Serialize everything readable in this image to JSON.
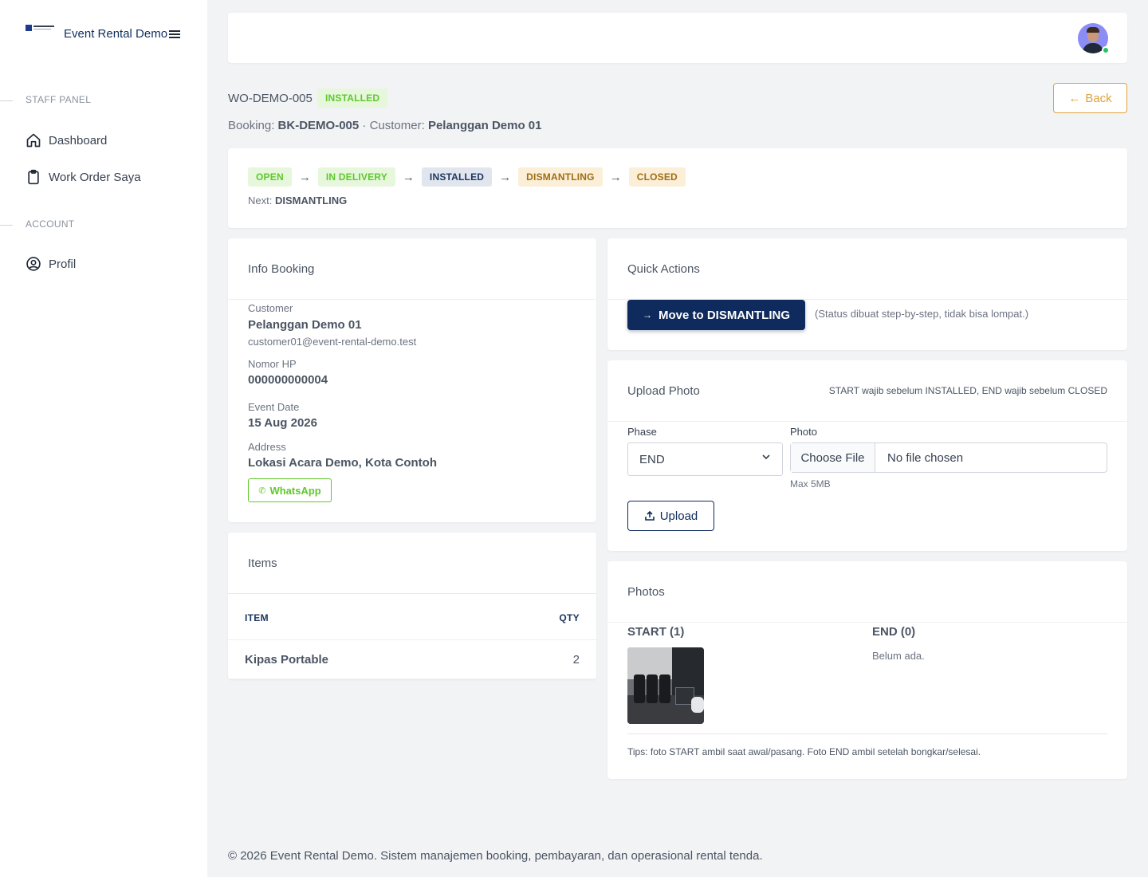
{
  "app": {
    "brand_name": "Event Rental Demo"
  },
  "sidebar": {
    "section_staff": "STAFF PANEL",
    "section_account": "ACCOUNT",
    "items": [
      {
        "label": "Dashboard",
        "icon": "home-icon"
      },
      {
        "label": "Work Order Saya",
        "icon": "clipboard-icon"
      },
      {
        "label": "Profil",
        "icon": "user-circle-icon"
      }
    ]
  },
  "header": {
    "wo_code": "WO-DEMO-005",
    "status": "INSTALLED",
    "booking_label": "Booking:",
    "booking_code": "BK-DEMO-005",
    "customer_label": "· Customer:",
    "customer_name": "Pelanggan Demo 01",
    "back_label": "Back"
  },
  "flow": {
    "steps": [
      "OPEN",
      "IN DELIVERY",
      "INSTALLED",
      "DISMANTLING",
      "CLOSED"
    ],
    "arrow": "→",
    "next_label": "Next:",
    "next_value": "DISMANTLING"
  },
  "info_booking": {
    "title": "Info Booking",
    "customer_label": "Customer",
    "customer_name": "Pelanggan Demo 01",
    "customer_email": "customer01@event-rental-demo.test",
    "phone_label": "Nomor HP",
    "phone": "000000000004",
    "event_date_label": "Event Date",
    "event_date": "15 Aug 2026",
    "address_label": "Address",
    "address": "Lokasi Acara Demo, Kota Contoh",
    "whatsapp_label": "WhatsApp"
  },
  "items": {
    "title": "Items",
    "headers": {
      "item": "ITEM",
      "qty": "QTY"
    },
    "rows": [
      {
        "item": "Kipas Portable",
        "qty": "2"
      }
    ]
  },
  "quick_actions": {
    "title": "Quick Actions",
    "move_label": "Move to DISMANTLING",
    "note": "(Status dibuat step-by-step, tidak bisa lompat.)"
  },
  "upload": {
    "title": "Upload Photo",
    "note": "START wajib sebelum INSTALLED, END wajib sebelum CLOSED",
    "phase_label": "Phase",
    "phase_value": "END",
    "photo_label": "Photo",
    "choose_file": "Choose File",
    "no_file": "No file chosen",
    "max_note": "Max 5MB",
    "upload_label": "Upload"
  },
  "photos": {
    "title": "Photos",
    "start_title": "START (1)",
    "end_title": "END (0)",
    "end_empty": "Belum ada.",
    "tips": "Tips: foto START ambil saat awal/pasang. Foto END ambil setelah bongkar/selesai."
  },
  "footer": {
    "text": "© 2026 Event Rental Demo. Sistem manajemen booking, pembayaran, dan operasional rental tenda."
  },
  "colors": {
    "primary": "#0f2a5c",
    "accent": "#e0a23a",
    "success": "#5fc82c",
    "background": "#f2f3f5"
  }
}
